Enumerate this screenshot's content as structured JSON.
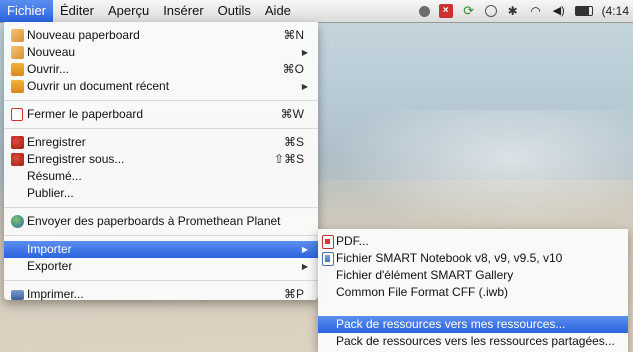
{
  "menubar": {
    "items": [
      "Fichier",
      "Éditer",
      "Aperçu",
      "Insérer",
      "Outils",
      "Aide"
    ],
    "clock": "(4:14"
  },
  "icons": {
    "status": [
      "status-dot-icon",
      "error-x-icon",
      "sync-icon",
      "time-machine-icon",
      "bluetooth-icon",
      "wifi-icon",
      "volume-icon",
      "battery-icon"
    ]
  },
  "file_menu": {
    "items": [
      {
        "label": "Nouveau paperboard",
        "shortcut": "⌘N"
      },
      {
        "label": "Nouveau",
        "arrow": "▶"
      },
      {
        "label": "Ouvrir...",
        "shortcut": "⌘O"
      },
      {
        "label": "Ouvrir un document récent",
        "arrow": "▶"
      },
      {
        "label": "Fermer le paperboard",
        "shortcut": "⌘W"
      },
      {
        "label": "Enregistrer",
        "shortcut": "⌘S"
      },
      {
        "label": "Enregistrer sous...",
        "shortcut": "⇧⌘S"
      },
      {
        "label": "Résumé..."
      },
      {
        "label": "Publier..."
      },
      {
        "label": "Envoyer des paperboards à Promethean Planet"
      },
      {
        "label": "Importer",
        "arrow": "▶"
      },
      {
        "label": "Exporter",
        "arrow": "▶"
      },
      {
        "label": "Imprimer...",
        "shortcut": "⌘P"
      }
    ]
  },
  "import_submenu": {
    "items": [
      {
        "label": "PDF..."
      },
      {
        "label": "Fichier SMART Notebook v8, v9, v9.5, v10"
      },
      {
        "label": "Fichier d'élément SMART Gallery"
      },
      {
        "label": "Common File Format CFF (.iwb)"
      },
      {
        "label": "Pack de ressources vers mes ressources..."
      },
      {
        "label": "Pack de ressources vers les ressources partagées..."
      }
    ]
  },
  "colors": {
    "highlight": "#2d63dd",
    "menu_bg": "#fafafa"
  }
}
